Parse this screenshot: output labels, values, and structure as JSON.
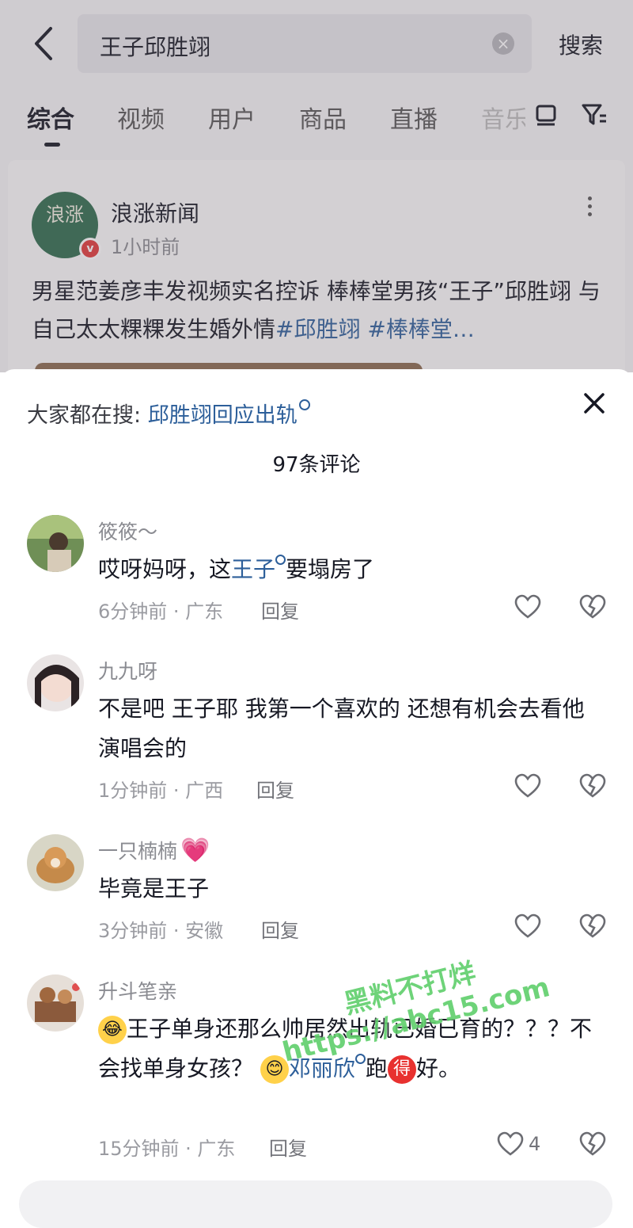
{
  "search": {
    "query": "王子邱胜翊",
    "submit_label": "搜索"
  },
  "tabs": [
    {
      "label": "综合"
    },
    {
      "label": "视频"
    },
    {
      "label": "用户"
    },
    {
      "label": "商品"
    },
    {
      "label": "直播"
    },
    {
      "label": "音乐"
    }
  ],
  "post": {
    "account_name": "浪涨新闻",
    "avatar_text": "浪涨",
    "verified_badge": "v",
    "time": "1小时前",
    "text_plain": "男星范姜彦丰发视频实名控诉 棒棒堂男孩“王子”邱胜翊 与自己太太粿粿发生婚外情",
    "hashtags": "#邱胜翊 #棒棒堂…"
  },
  "sheet": {
    "hot_label": "大家都在搜:",
    "hot_query": "邱胜翊回应出轨",
    "count": "97条评论",
    "reply_label": "回复"
  },
  "comments": [
    {
      "name": "筱筱～",
      "text_a": "哎呀妈呀，这",
      "link": "王子",
      "text_b": "要塌房了",
      "meta": "6分钟前 · 广东"
    },
    {
      "name": "九九呀",
      "text": "不是吧  王子耶  我第一个喜欢的  还想有机会去看他演唱会的",
      "meta": "1分钟前 · 广西"
    },
    {
      "name": "一只楠楠",
      "text": "毕竟是王子",
      "meta": "3分钟前 · 安徽"
    },
    {
      "name": "升斗笔亲",
      "text_a": "王子单身还那么帅居然出轨已婚已育的？？？不会找单身女孩？",
      "link": "邓丽欣",
      "text_b": "跑",
      "badge": "得",
      "text_c": "好。",
      "meta": "15分钟前 · 广东",
      "likes": "4"
    }
  ],
  "watermark": {
    "line1": "黑料不打烊",
    "line2": "https://abc15.com"
  },
  "colors": {
    "link": "#2d5f9a",
    "badge_red": "#e13a39",
    "watermark": "#5fcf6b"
  }
}
